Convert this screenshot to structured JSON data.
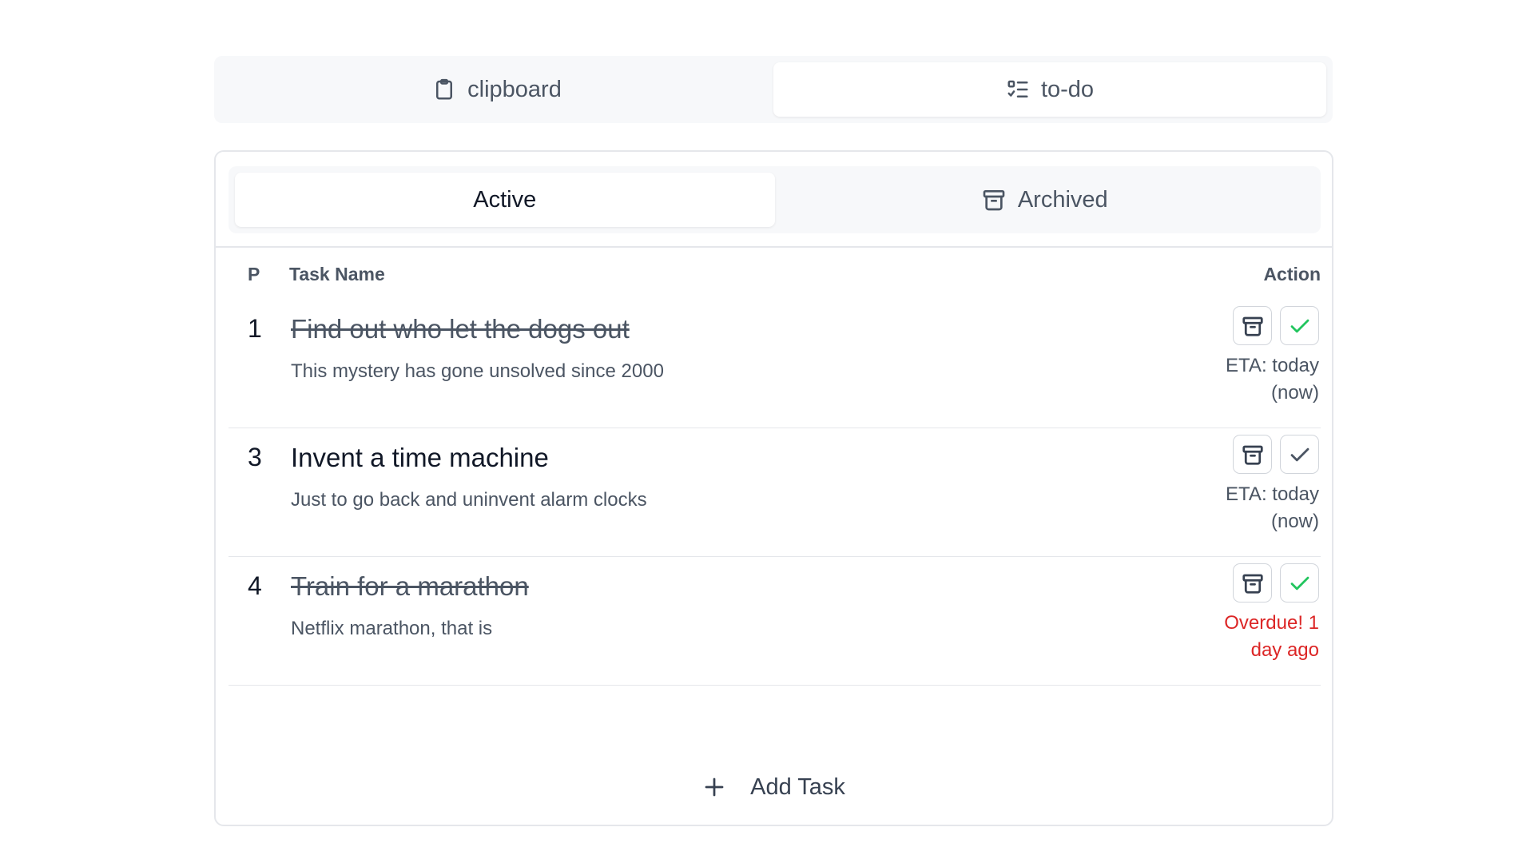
{
  "top_tabs": [
    {
      "label": "clipboard",
      "icon": "clipboard-icon",
      "active": false
    },
    {
      "label": "to-do",
      "icon": "list-checks-icon",
      "active": true
    }
  ],
  "sub_tabs": [
    {
      "label": "Active",
      "active": true
    },
    {
      "label": "Archived",
      "icon": "archive-icon",
      "active": false
    }
  ],
  "table": {
    "headers": {
      "priority": "P",
      "name": "Task Name",
      "action": "Action"
    },
    "rows": [
      {
        "priority": "1",
        "title": "Find out who let the dogs out",
        "description": "This mystery has gone unsolved since 2000",
        "done": true,
        "eta_line1": "ETA: today",
        "eta_line2": "(now)",
        "overdue": false
      },
      {
        "priority": "3",
        "title": "Invent a time machine",
        "description": "Just to go back and uninvent alarm clocks",
        "done": false,
        "eta_line1": "ETA: today",
        "eta_line2": "(now)",
        "overdue": false
      },
      {
        "priority": "4",
        "title": "Train for a marathon",
        "description": "Netflix marathon, that is",
        "done": true,
        "eta_line1": "Overdue! 1",
        "eta_line2": "day ago",
        "overdue": true
      }
    ]
  },
  "add_task_label": "Add Task",
  "colors": {
    "done_check": "#22c55e",
    "pending_check": "#4b5563",
    "overdue": "#dc2626"
  }
}
